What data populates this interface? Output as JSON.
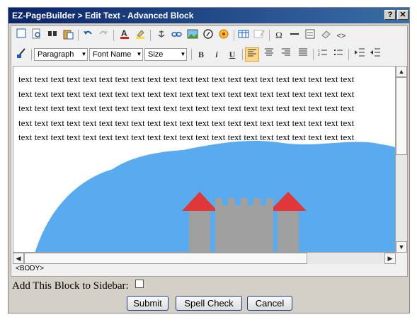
{
  "window": {
    "title": "EZ-PageBuilder > Edit Text - Advanced Block",
    "help_label": "?",
    "close_label": "✕"
  },
  "toolbar": {
    "row1_icons": [
      "toggle-source-icon",
      "preview-icon",
      "find-icon",
      "paste-special-icon",
      "undo-icon",
      "redo-icon",
      "font-color-icon",
      "highlight-color-icon",
      "anchor-icon",
      "link-icon",
      "image-icon",
      "flash-icon",
      "media-icon",
      "table-icon",
      "table-edit-icon",
      "special-char-icon",
      "horizontal-rule-icon",
      "form-icon",
      "eraser-icon",
      "code-icon"
    ],
    "format_value": "Paragraph",
    "font_value": "Font Name",
    "size_value": "Size",
    "bold_label": "B",
    "italic_label": "i",
    "underline_label": "U"
  },
  "content": {
    "lines": [
      "text text text text text text text text text text text text text text text text text text text text text",
      "text text text text text text text text text text text text text text text text text text text text text",
      "text text text text text text text text text text text text text text text text text text text text text",
      "text text text text text text text text text text text text text text text text text text text text text",
      "text text text text text text text text text text text text text text text text text text text text text"
    ]
  },
  "statusbar": {
    "path": "<BODY>"
  },
  "form": {
    "sidebar_label": "Add This Block to Sidebar:",
    "sidebar_checked": false,
    "submit_label": "Submit",
    "spellcheck_label": "Spell Check",
    "cancel_label": "Cancel"
  },
  "colors": {
    "title_bar": "#0a246a",
    "hill": "#5aabee",
    "castle": "#a0a0a0",
    "roof": "#e03838",
    "active_button": "#ffd88a"
  }
}
